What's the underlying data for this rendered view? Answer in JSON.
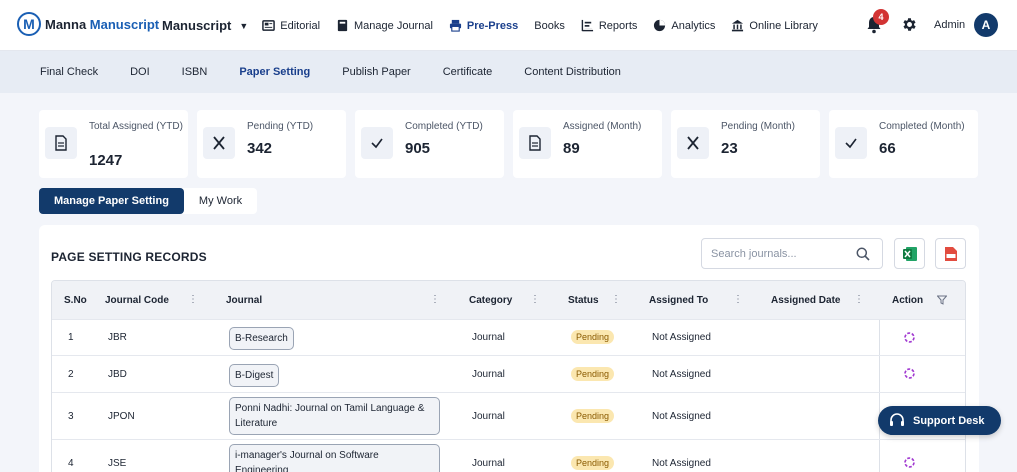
{
  "brand": {
    "name_part1": "Manna",
    "name_part2": "Manuscript",
    "badge": "M"
  },
  "nav": {
    "first": "Manuscript",
    "items": [
      {
        "label": "Editorial",
        "icon": "newspaper-icon"
      },
      {
        "label": "Manage Journal",
        "icon": "book-icon"
      },
      {
        "label": "Pre-Press",
        "icon": "printer-icon",
        "active": true
      },
      {
        "label": "Books",
        "icon": ""
      },
      {
        "label": "Reports",
        "icon": "chart-bar-icon"
      },
      {
        "label": "Analytics",
        "icon": "pie-chart-icon"
      },
      {
        "label": "Online Library",
        "icon": "institution-icon"
      }
    ],
    "notification_count": "4",
    "admin_label": "Admin",
    "avatar_letter": "A"
  },
  "subnav": {
    "items": [
      "Final Check",
      "DOI",
      "ISBN",
      "Paper Setting",
      "Publish Paper",
      "Certificate",
      "Content Distribution"
    ],
    "active": "Paper Setting"
  },
  "stats": [
    {
      "label": "Total Assigned (YTD)",
      "value": "1247",
      "icon": "document-icon"
    },
    {
      "label": "Pending (YTD)",
      "value": "342",
      "icon": "x-icon"
    },
    {
      "label": "Completed (YTD)",
      "value": "905",
      "icon": "check-icon"
    },
    {
      "label": "Assigned (Month)",
      "value": "89",
      "icon": "document-icon"
    },
    {
      "label": "Pending (Month)",
      "value": "23",
      "icon": "x-icon"
    },
    {
      "label": "Completed (Month)",
      "value": "66",
      "icon": "check-icon"
    }
  ],
  "tabs": {
    "manage": "Manage Paper Setting",
    "mywork": "My Work"
  },
  "records": {
    "title": "PAGE SETTING RECORDS",
    "search_placeholder": "Search journals...",
    "columns": {
      "sno": "S.No",
      "code": "Journal Code",
      "journal": "Journal",
      "category": "Category",
      "status": "Status",
      "assigned_to": "Assigned To",
      "assigned_date": "Assigned Date",
      "action": "Action"
    },
    "rows": [
      {
        "sno": "1",
        "code": "JBR",
        "journal": "B-Research",
        "category": "Journal",
        "status": "Pending",
        "assigned_to": "Not Assigned",
        "assigned_date": ""
      },
      {
        "sno": "2",
        "code": "JBD",
        "journal": "B-Digest",
        "category": "Journal",
        "status": "Pending",
        "assigned_to": "Not Assigned",
        "assigned_date": ""
      },
      {
        "sno": "3",
        "code": "JPON",
        "journal": "Ponni Nadhi: Journal on Tamil Language & Literature",
        "category": "Journal",
        "status": "Pending",
        "assigned_to": "Not Assigned",
        "assigned_date": ""
      },
      {
        "sno": "4",
        "code": "JSE",
        "journal": "i-manager's Journal on Software Engineering",
        "category": "Journal",
        "status": "Pending",
        "assigned_to": "Not Assigned",
        "assigned_date": ""
      }
    ]
  },
  "support": {
    "label": "Support Desk"
  },
  "colors": {
    "primary": "#123a6b",
    "accent": "#1a5fb4",
    "pending_bg": "#fbe7b0",
    "action_icon": "#a23bd1"
  }
}
